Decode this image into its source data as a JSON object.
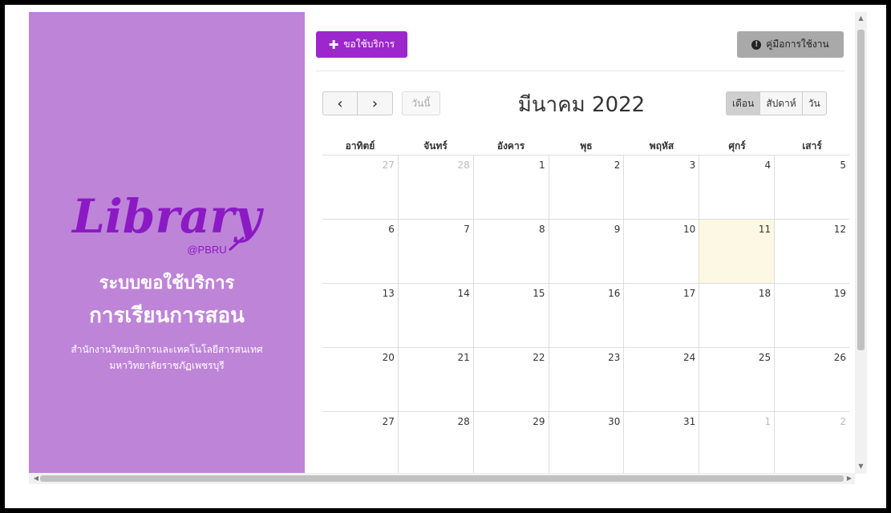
{
  "brand": {
    "logo_text": "Library",
    "logo_sub": "@PBRU",
    "title_line1": "ระบบขอใช้บริการ",
    "title_line2": "การเรียนการสอน",
    "org_line1": "สำนักงานวิทยบริการและเทคโนโลยีสารสนเทศ",
    "org_line2": "มหาวิทยาลัยราชภัฏเพชรบุรี",
    "panel_color": "#be84d8",
    "logo_color": "#8b1ac4"
  },
  "toolbar": {
    "request_icon": "plus-icon",
    "request_label": "ขอใช้บริการ",
    "manual_icon": "info-icon",
    "manual_label": "คู่มือการใช้งาน"
  },
  "calendar": {
    "prev_label": "‹",
    "next_label": "›",
    "today_label": "วันนี้",
    "title": "มีนาคม 2022",
    "views": [
      {
        "label": "เดือน",
        "active": true
      },
      {
        "label": "สัปดาห์",
        "active": false
      },
      {
        "label": "วัน",
        "active": false
      }
    ],
    "weekdays": [
      "อาทิตย์",
      "จันทร์",
      "อังคาร",
      "พุธ",
      "พฤหัส",
      "ศุกร์",
      "เสาร์"
    ],
    "weeks": [
      [
        {
          "d": "27",
          "other": true
        },
        {
          "d": "28",
          "other": true
        },
        {
          "d": "1"
        },
        {
          "d": "2"
        },
        {
          "d": "3"
        },
        {
          "d": "4"
        },
        {
          "d": "5"
        }
      ],
      [
        {
          "d": "6"
        },
        {
          "d": "7"
        },
        {
          "d": "8"
        },
        {
          "d": "9"
        },
        {
          "d": "10"
        },
        {
          "d": "11",
          "today": true
        },
        {
          "d": "12"
        }
      ],
      [
        {
          "d": "13"
        },
        {
          "d": "14"
        },
        {
          "d": "15"
        },
        {
          "d": "16"
        },
        {
          "d": "17"
        },
        {
          "d": "18"
        },
        {
          "d": "19"
        }
      ],
      [
        {
          "d": "20"
        },
        {
          "d": "21"
        },
        {
          "d": "22"
        },
        {
          "d": "23"
        },
        {
          "d": "24"
        },
        {
          "d": "25"
        },
        {
          "d": "26"
        }
      ],
      [
        {
          "d": "27"
        },
        {
          "d": "28"
        },
        {
          "d": "29"
        },
        {
          "d": "30"
        },
        {
          "d": "31"
        },
        {
          "d": "1",
          "other": true
        },
        {
          "d": "2",
          "other": true
        }
      ]
    ],
    "today_color": "#fcf8e3"
  },
  "colors": {
    "accent": "#9c27cc",
    "manual_button": "#a9a9a9"
  }
}
